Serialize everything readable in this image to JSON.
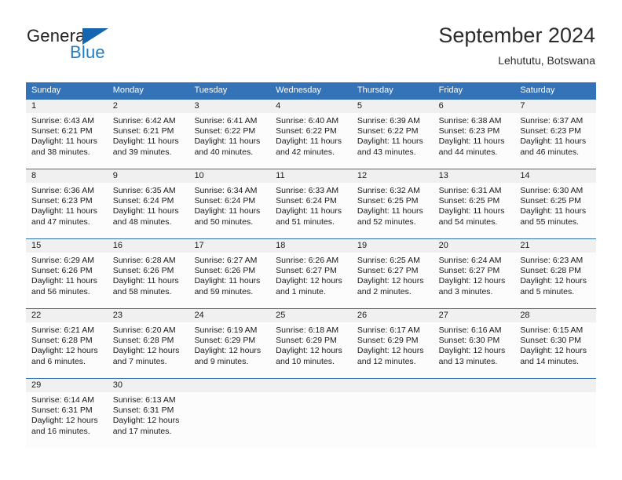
{
  "brand": {
    "name_part1": "General",
    "name_part2": "Blue",
    "triangle_color": "#1565b0",
    "blue_color": "#1f7cc4"
  },
  "header": {
    "title": "September 2024",
    "subtitle": "Lehututu, Botswana"
  },
  "theme": {
    "header_bar_color": "#3573b8",
    "week_separator_color": "#2f6fb0",
    "date_band_color": "#f0f0f0",
    "cell_background": "#fcfcfc"
  },
  "weekdays": [
    "Sunday",
    "Monday",
    "Tuesday",
    "Wednesday",
    "Thursday",
    "Friday",
    "Saturday"
  ],
  "weeks": [
    {
      "days": [
        {
          "date": "1",
          "sunrise": "Sunrise: 6:43 AM",
          "sunset": "Sunset: 6:21 PM",
          "daylight_line1": "Daylight: 11 hours",
          "daylight_line2": "and 38 minutes."
        },
        {
          "date": "2",
          "sunrise": "Sunrise: 6:42 AM",
          "sunset": "Sunset: 6:21 PM",
          "daylight_line1": "Daylight: 11 hours",
          "daylight_line2": "and 39 minutes."
        },
        {
          "date": "3",
          "sunrise": "Sunrise: 6:41 AM",
          "sunset": "Sunset: 6:22 PM",
          "daylight_line1": "Daylight: 11 hours",
          "daylight_line2": "and 40 minutes."
        },
        {
          "date": "4",
          "sunrise": "Sunrise: 6:40 AM",
          "sunset": "Sunset: 6:22 PM",
          "daylight_line1": "Daylight: 11 hours",
          "daylight_line2": "and 42 minutes."
        },
        {
          "date": "5",
          "sunrise": "Sunrise: 6:39 AM",
          "sunset": "Sunset: 6:22 PM",
          "daylight_line1": "Daylight: 11 hours",
          "daylight_line2": "and 43 minutes."
        },
        {
          "date": "6",
          "sunrise": "Sunrise: 6:38 AM",
          "sunset": "Sunset: 6:23 PM",
          "daylight_line1": "Daylight: 11 hours",
          "daylight_line2": "and 44 minutes."
        },
        {
          "date": "7",
          "sunrise": "Sunrise: 6:37 AM",
          "sunset": "Sunset: 6:23 PM",
          "daylight_line1": "Daylight: 11 hours",
          "daylight_line2": "and 46 minutes."
        }
      ]
    },
    {
      "days": [
        {
          "date": "8",
          "sunrise": "Sunrise: 6:36 AM",
          "sunset": "Sunset: 6:23 PM",
          "daylight_line1": "Daylight: 11 hours",
          "daylight_line2": "and 47 minutes."
        },
        {
          "date": "9",
          "sunrise": "Sunrise: 6:35 AM",
          "sunset": "Sunset: 6:24 PM",
          "daylight_line1": "Daylight: 11 hours",
          "daylight_line2": "and 48 minutes."
        },
        {
          "date": "10",
          "sunrise": "Sunrise: 6:34 AM",
          "sunset": "Sunset: 6:24 PM",
          "daylight_line1": "Daylight: 11 hours",
          "daylight_line2": "and 50 minutes."
        },
        {
          "date": "11",
          "sunrise": "Sunrise: 6:33 AM",
          "sunset": "Sunset: 6:24 PM",
          "daylight_line1": "Daylight: 11 hours",
          "daylight_line2": "and 51 minutes."
        },
        {
          "date": "12",
          "sunrise": "Sunrise: 6:32 AM",
          "sunset": "Sunset: 6:25 PM",
          "daylight_line1": "Daylight: 11 hours",
          "daylight_line2": "and 52 minutes."
        },
        {
          "date": "13",
          "sunrise": "Sunrise: 6:31 AM",
          "sunset": "Sunset: 6:25 PM",
          "daylight_line1": "Daylight: 11 hours",
          "daylight_line2": "and 54 minutes."
        },
        {
          "date": "14",
          "sunrise": "Sunrise: 6:30 AM",
          "sunset": "Sunset: 6:25 PM",
          "daylight_line1": "Daylight: 11 hours",
          "daylight_line2": "and 55 minutes."
        }
      ]
    },
    {
      "days": [
        {
          "date": "15",
          "sunrise": "Sunrise: 6:29 AM",
          "sunset": "Sunset: 6:26 PM",
          "daylight_line1": "Daylight: 11 hours",
          "daylight_line2": "and 56 minutes."
        },
        {
          "date": "16",
          "sunrise": "Sunrise: 6:28 AM",
          "sunset": "Sunset: 6:26 PM",
          "daylight_line1": "Daylight: 11 hours",
          "daylight_line2": "and 58 minutes."
        },
        {
          "date": "17",
          "sunrise": "Sunrise: 6:27 AM",
          "sunset": "Sunset: 6:26 PM",
          "daylight_line1": "Daylight: 11 hours",
          "daylight_line2": "and 59 minutes."
        },
        {
          "date": "18",
          "sunrise": "Sunrise: 6:26 AM",
          "sunset": "Sunset: 6:27 PM",
          "daylight_line1": "Daylight: 12 hours",
          "daylight_line2": "and 1 minute."
        },
        {
          "date": "19",
          "sunrise": "Sunrise: 6:25 AM",
          "sunset": "Sunset: 6:27 PM",
          "daylight_line1": "Daylight: 12 hours",
          "daylight_line2": "and 2 minutes."
        },
        {
          "date": "20",
          "sunrise": "Sunrise: 6:24 AM",
          "sunset": "Sunset: 6:27 PM",
          "daylight_line1": "Daylight: 12 hours",
          "daylight_line2": "and 3 minutes."
        },
        {
          "date": "21",
          "sunrise": "Sunrise: 6:23 AM",
          "sunset": "Sunset: 6:28 PM",
          "daylight_line1": "Daylight: 12 hours",
          "daylight_line2": "and 5 minutes."
        }
      ]
    },
    {
      "days": [
        {
          "date": "22",
          "sunrise": "Sunrise: 6:21 AM",
          "sunset": "Sunset: 6:28 PM",
          "daylight_line1": "Daylight: 12 hours",
          "daylight_line2": "and 6 minutes."
        },
        {
          "date": "23",
          "sunrise": "Sunrise: 6:20 AM",
          "sunset": "Sunset: 6:28 PM",
          "daylight_line1": "Daylight: 12 hours",
          "daylight_line2": "and 7 minutes."
        },
        {
          "date": "24",
          "sunrise": "Sunrise: 6:19 AM",
          "sunset": "Sunset: 6:29 PM",
          "daylight_line1": "Daylight: 12 hours",
          "daylight_line2": "and 9 minutes."
        },
        {
          "date": "25",
          "sunrise": "Sunrise: 6:18 AM",
          "sunset": "Sunset: 6:29 PM",
          "daylight_line1": "Daylight: 12 hours",
          "daylight_line2": "and 10 minutes."
        },
        {
          "date": "26",
          "sunrise": "Sunrise: 6:17 AM",
          "sunset": "Sunset: 6:29 PM",
          "daylight_line1": "Daylight: 12 hours",
          "daylight_line2": "and 12 minutes."
        },
        {
          "date": "27",
          "sunrise": "Sunrise: 6:16 AM",
          "sunset": "Sunset: 6:30 PM",
          "daylight_line1": "Daylight: 12 hours",
          "daylight_line2": "and 13 minutes."
        },
        {
          "date": "28",
          "sunrise": "Sunrise: 6:15 AM",
          "sunset": "Sunset: 6:30 PM",
          "daylight_line1": "Daylight: 12 hours",
          "daylight_line2": "and 14 minutes."
        }
      ]
    },
    {
      "days": [
        {
          "date": "29",
          "sunrise": "Sunrise: 6:14 AM",
          "sunset": "Sunset: 6:31 PM",
          "daylight_line1": "Daylight: 12 hours",
          "daylight_line2": "and 16 minutes."
        },
        {
          "date": "30",
          "sunrise": "Sunrise: 6:13 AM",
          "sunset": "Sunset: 6:31 PM",
          "daylight_line1": "Daylight: 12 hours",
          "daylight_line2": "and 17 minutes."
        },
        {
          "date": "",
          "sunrise": "",
          "sunset": "",
          "daylight_line1": "",
          "daylight_line2": ""
        },
        {
          "date": "",
          "sunrise": "",
          "sunset": "",
          "daylight_line1": "",
          "daylight_line2": ""
        },
        {
          "date": "",
          "sunrise": "",
          "sunset": "",
          "daylight_line1": "",
          "daylight_line2": ""
        },
        {
          "date": "",
          "sunrise": "",
          "sunset": "",
          "daylight_line1": "",
          "daylight_line2": ""
        },
        {
          "date": "",
          "sunrise": "",
          "sunset": "",
          "daylight_line1": "",
          "daylight_line2": ""
        }
      ]
    }
  ]
}
